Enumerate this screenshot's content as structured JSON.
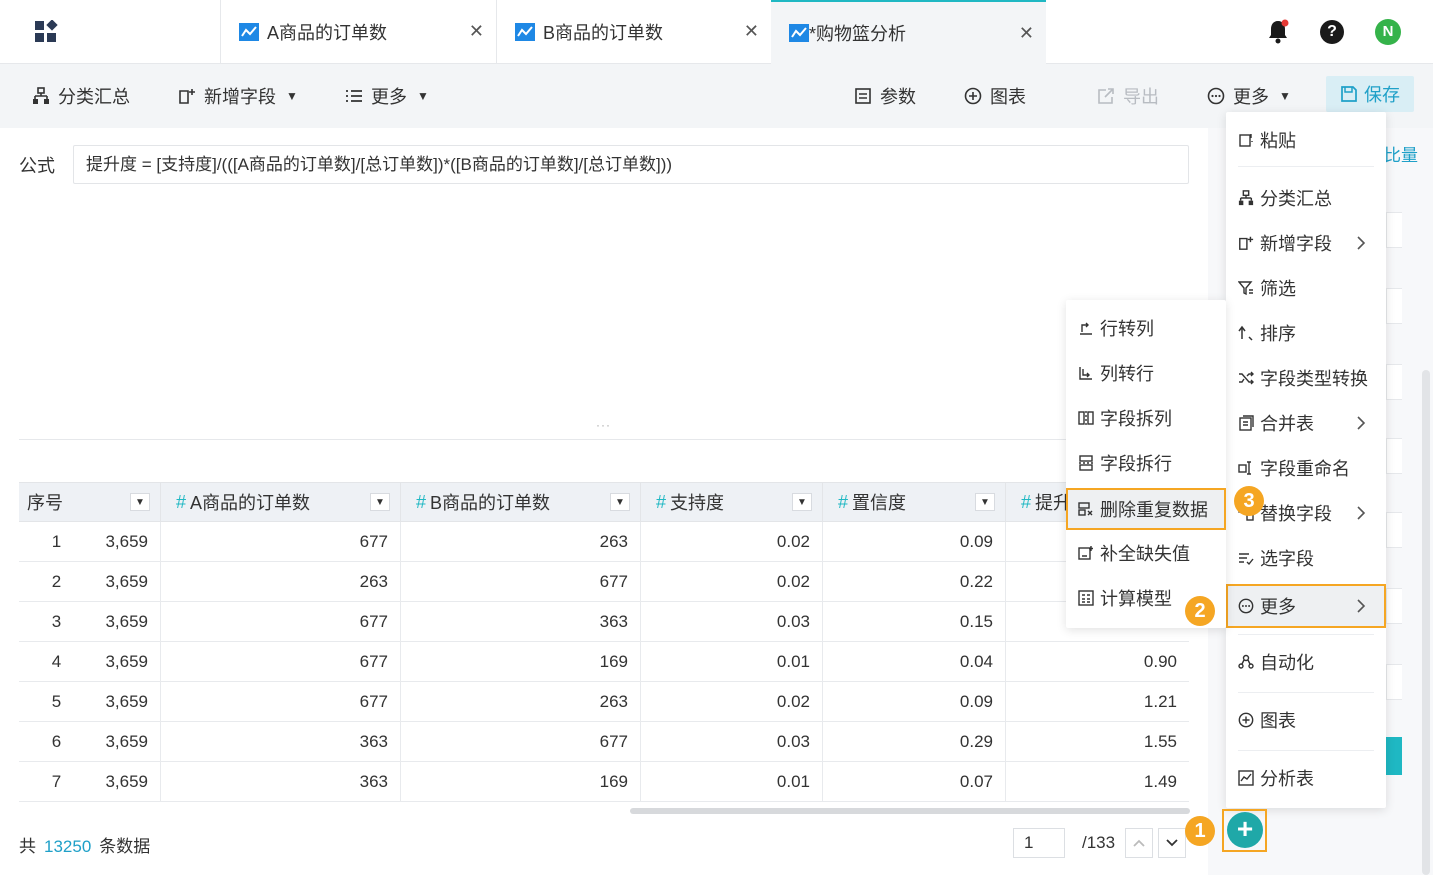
{
  "tabs": [
    {
      "label": "A商品的订单数"
    },
    {
      "label": "B商品的订单数"
    },
    {
      "label": "*购物篮分析"
    }
  ],
  "header_right": {
    "help": "?",
    "avatar": "N"
  },
  "toolbar": {
    "group_summary": "分类汇总",
    "add_field": "新增字段",
    "more_left": "更多",
    "params": "参数",
    "chart": "图表",
    "export": "导出",
    "more_right": "更多",
    "save": "保存"
  },
  "formula": {
    "label": "公式",
    "value": "提升度 = [支持度]/(([A商品的订单数]/[总订单数])*([B商品的订单数]/[总订单数]))"
  },
  "right_panel": {
    "partial_text": "比量"
  },
  "table": {
    "columns": [
      "序号",
      "A商品的订单数",
      "B商品的订单数",
      "支持度",
      "置信度",
      "提升"
    ],
    "rows": [
      {
        "idx": "1",
        "total": "3,659",
        "a": "677",
        "b": "263",
        "support": "0.02",
        "confidence": "0.09",
        "lift": ""
      },
      {
        "idx": "2",
        "total": "3,659",
        "a": "263",
        "b": "677",
        "support": "0.02",
        "confidence": "0.22",
        "lift": ""
      },
      {
        "idx": "3",
        "total": "3,659",
        "a": "677",
        "b": "363",
        "support": "0.03",
        "confidence": "0.15",
        "lift": ""
      },
      {
        "idx": "4",
        "total": "3,659",
        "a": "677",
        "b": "169",
        "support": "0.01",
        "confidence": "0.04",
        "lift": "0.90"
      },
      {
        "idx": "5",
        "total": "3,659",
        "a": "677",
        "b": "263",
        "support": "0.02",
        "confidence": "0.09",
        "lift": "1.21"
      },
      {
        "idx": "6",
        "total": "3,659",
        "a": "363",
        "b": "677",
        "support": "0.03",
        "confidence": "0.29",
        "lift": "1.55"
      },
      {
        "idx": "7",
        "total": "3,659",
        "a": "363",
        "b": "169",
        "support": "0.01",
        "confidence": "0.07",
        "lift": "1.49"
      }
    ]
  },
  "footer": {
    "prefix": "共",
    "count": "13250",
    "suffix": "条数据",
    "page": "1",
    "page_total": "/133"
  },
  "menu_main": [
    {
      "label": "粘贴"
    },
    {
      "label": "分类汇总"
    },
    {
      "label": "新增字段"
    },
    {
      "label": "筛选"
    },
    {
      "label": "排序"
    },
    {
      "label": "字段类型转换"
    },
    {
      "label": "合并表"
    },
    {
      "label": "字段重命名"
    },
    {
      "label": "替换字段"
    },
    {
      "label": "选字段"
    },
    {
      "label": "更多"
    },
    {
      "label": "自动化"
    },
    {
      "label": "图表"
    },
    {
      "label": "分析表"
    }
  ],
  "menu_sub": [
    {
      "label": "行转列"
    },
    {
      "label": "列转行"
    },
    {
      "label": "字段拆列"
    },
    {
      "label": "字段拆行"
    },
    {
      "label": "删除重复数据"
    },
    {
      "label": "补全缺失值"
    },
    {
      "label": "计算模型"
    }
  ],
  "badges": {
    "one": "1",
    "two": "2",
    "three": "3"
  },
  "fab": {
    "label": "+"
  },
  "colors": {
    "accent": "#1fb8c3",
    "highlight": "#f5a623",
    "link": "#1fa0c8"
  }
}
